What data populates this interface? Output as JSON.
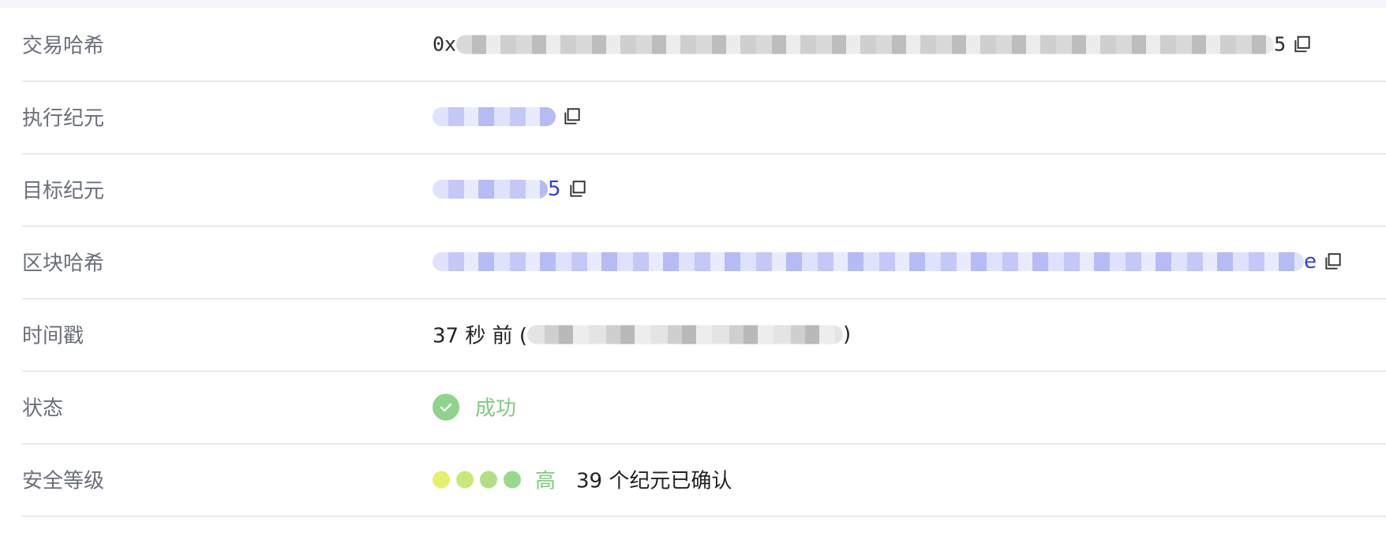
{
  "rows": {
    "tx_hash": {
      "label": "交易哈希",
      "prefix": "0x",
      "suffix": "5"
    },
    "exec_epoch": {
      "label": "执行纪元"
    },
    "target_epoch": {
      "label": "目标纪元",
      "suffix": "5"
    },
    "block_hash": {
      "label": "区块哈希",
      "suffix": "e"
    },
    "timestamp": {
      "label": "时间戳",
      "relative": "37 秒 前 (",
      "close": ")"
    },
    "status": {
      "label": "状态",
      "value": "成功",
      "icon": "check-circle-icon",
      "color": "#8fd38f"
    },
    "security": {
      "label": "安全等级",
      "level": "高",
      "confirmations": "39 个纪元已确认",
      "dot_colors": [
        "#e6f06f",
        "#c9e77b",
        "#b2df86",
        "#9ad98d"
      ]
    }
  }
}
